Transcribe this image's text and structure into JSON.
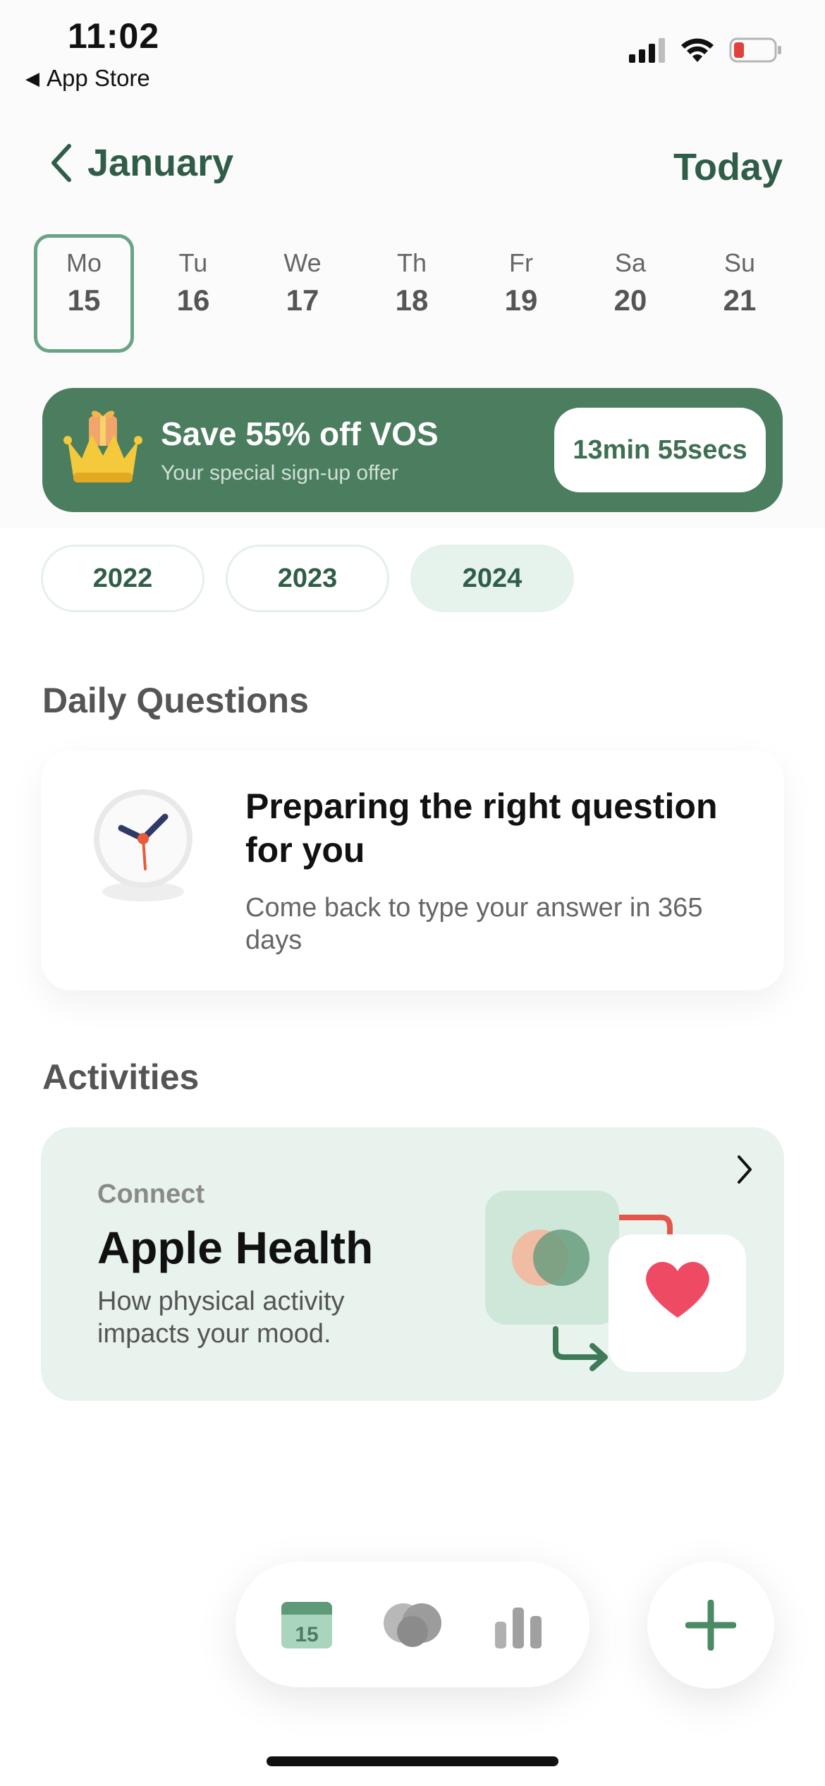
{
  "status_bar": {
    "time": "11:02",
    "back_app": "App Store",
    "back_arrow": "◀",
    "icons": [
      "cellular-signal-icon",
      "wifi-icon",
      "battery-low-icon"
    ]
  },
  "header": {
    "month": "January",
    "today_label": "Today",
    "back_icon": "chevron-left-icon"
  },
  "week": [
    {
      "name": "Mo",
      "num": "15",
      "selected": true
    },
    {
      "name": "Tu",
      "num": "16"
    },
    {
      "name": "We",
      "num": "17"
    },
    {
      "name": "Th",
      "num": "18"
    },
    {
      "name": "Fr",
      "num": "19"
    },
    {
      "name": "Sa",
      "num": "20"
    },
    {
      "name": "Su",
      "num": "21"
    }
  ],
  "offer": {
    "title": "Save 55% off VOS",
    "subtitle": "Your special sign-up offer",
    "timer": "13min 55secs",
    "icon": "crown-gift-icon",
    "color": "#4b7d5f"
  },
  "years": [
    {
      "label": "2022"
    },
    {
      "label": "2023"
    },
    {
      "label": "2024",
      "active": true
    }
  ],
  "daily_questions": {
    "section_title": "Daily Questions",
    "title": "Preparing the right question for you",
    "subtitle": "Come back to type your answer in 365 days",
    "icon": "clock-icon"
  },
  "activities": {
    "section_title": "Activities",
    "small_label": "Connect",
    "title": "Apple Health",
    "subtitle": "How physical activity impacts your mood.",
    "icon": "health-sync-illustration"
  },
  "tabbar": {
    "calendar_day": "15",
    "tabs": [
      "calendar-icon",
      "mood-hearts-icon",
      "stats-bars-icon"
    ],
    "add_icon": "plus-icon"
  },
  "colors": {
    "accent": "#2f5d47",
    "selected_border": "#6aa488",
    "light_green": "#e8f3ed"
  }
}
